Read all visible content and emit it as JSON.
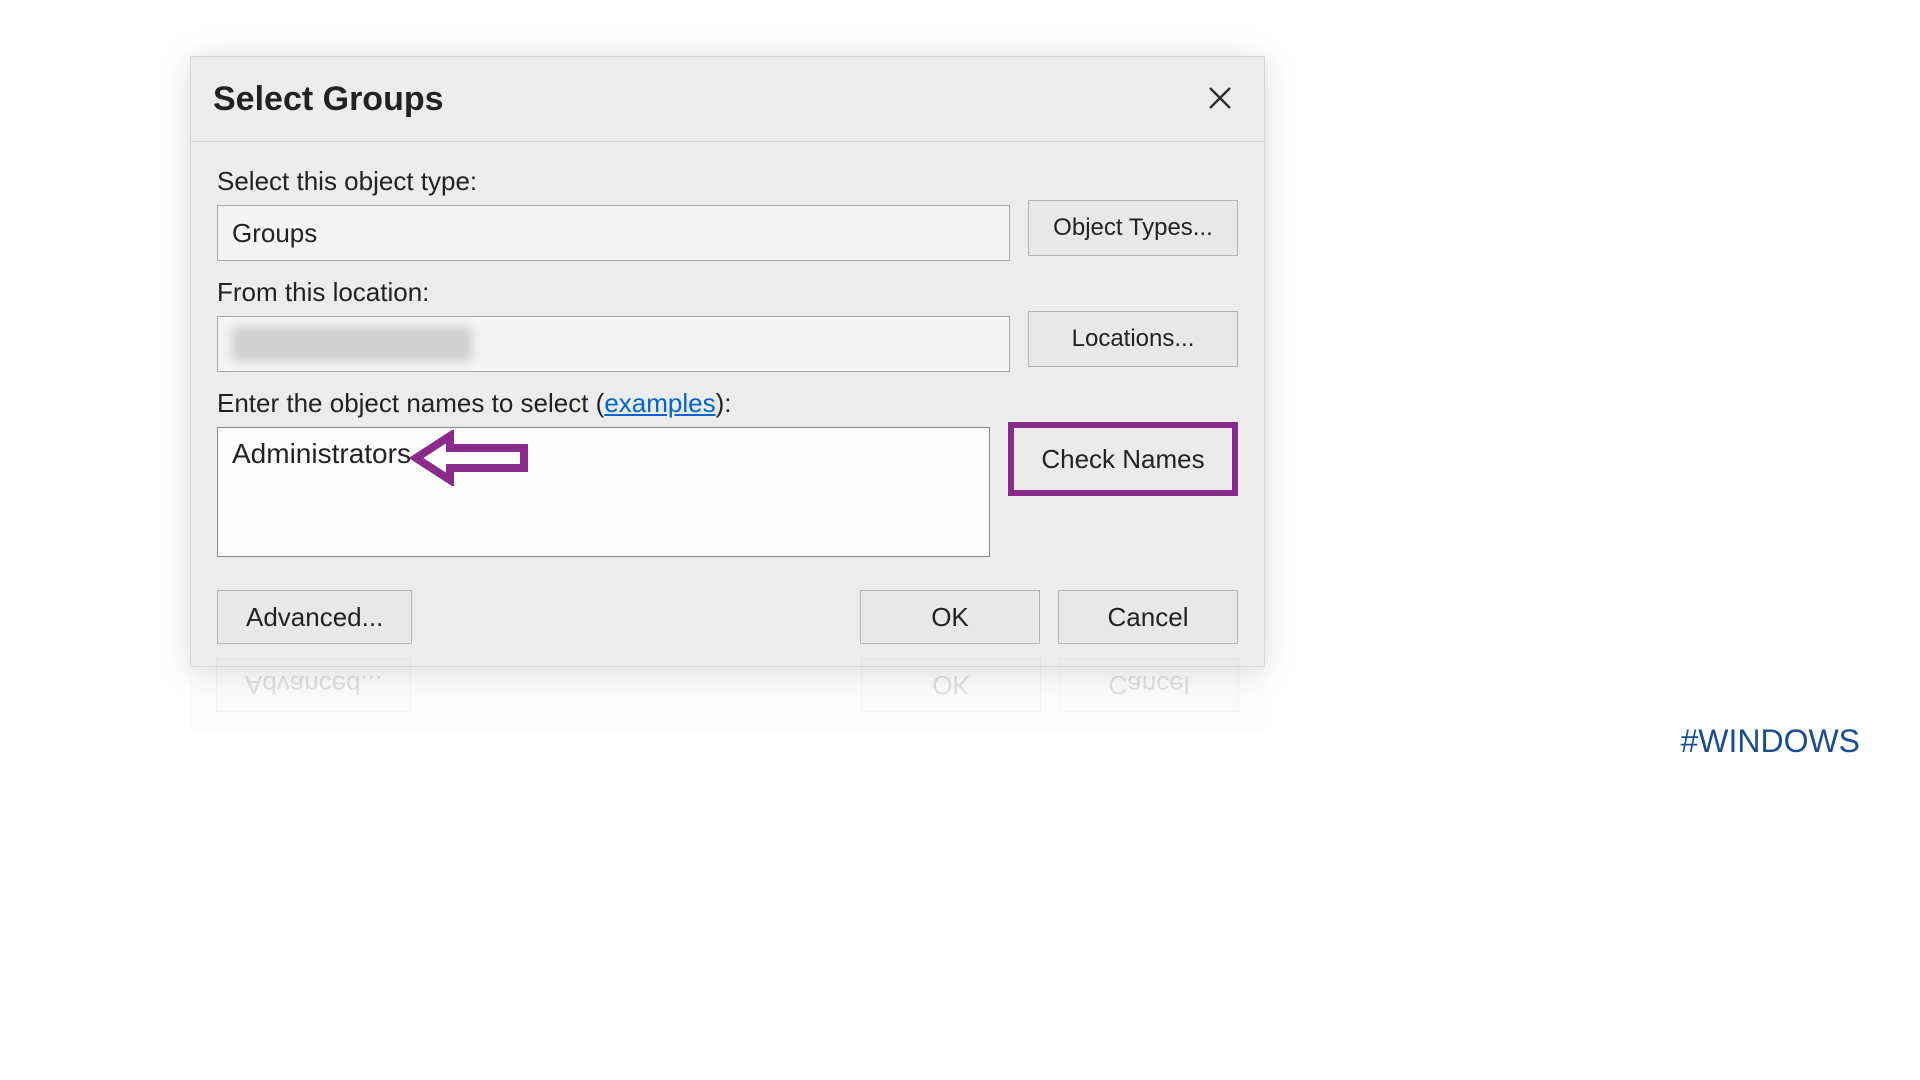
{
  "dialog": {
    "title": "Select Groups",
    "object_type": {
      "label": "Select this object type:",
      "value": "Groups",
      "button": "Object Types..."
    },
    "location": {
      "label": "From this location:",
      "value": "",
      "button": "Locations..."
    },
    "names": {
      "label_prefix": "Enter the object names to select (",
      "label_link": "examples",
      "label_suffix": "):",
      "value": "Administrators",
      "check_button": "Check Names"
    },
    "buttons": {
      "advanced": "Advanced...",
      "ok": "OK",
      "cancel": "Cancel"
    }
  },
  "annotations": {
    "hashtag": "#WINDOWS",
    "highlight_color": "#8a2a8a"
  }
}
